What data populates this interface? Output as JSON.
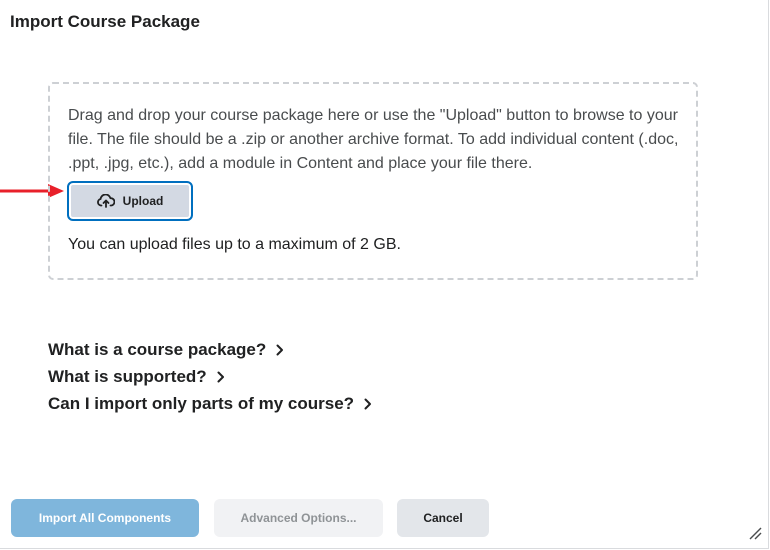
{
  "dialog": {
    "title": "Import Course Package"
  },
  "dropzone": {
    "instructions": "Drag and drop your course package here or use the \"Upload\" button to browse to your file. The file should be a .zip or another archive format. To add individual content (.doc, .ppt, .jpg, etc.), add a module in Content and place your file there.",
    "upload_label": "Upload",
    "upload_icon": "cloud-upload-icon",
    "max_size_note": "You can upload files up to a maximum of 2 GB."
  },
  "annotation": {
    "arrow_color": "#e8202a"
  },
  "faq": [
    {
      "label": "What is a course package?"
    },
    {
      "label": "What is supported?"
    },
    {
      "label": "Can I import only parts of my course?"
    }
  ],
  "footer": {
    "import_all_label": "Import All Components",
    "advanced_label": "Advanced Options...",
    "cancel_label": "Cancel"
  },
  "colors": {
    "accent": "#006fbf",
    "primary_disabled": "#7fb6dc"
  }
}
